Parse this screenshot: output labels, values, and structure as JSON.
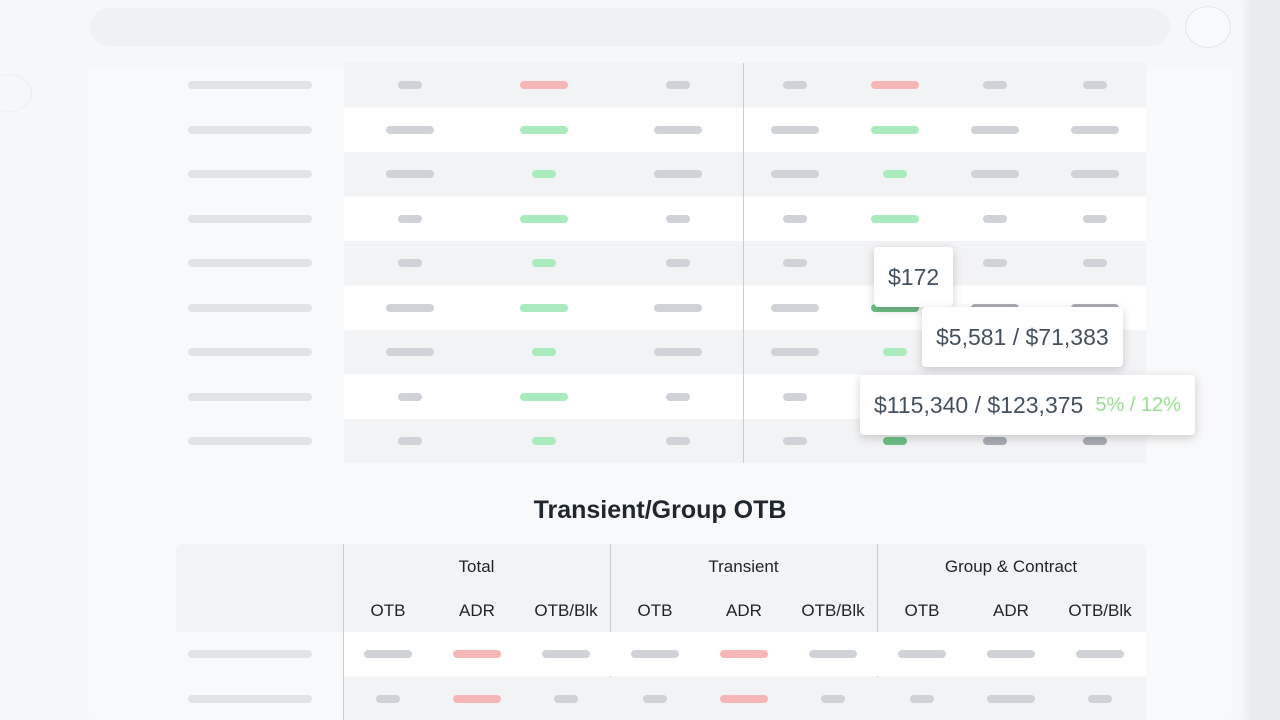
{
  "tooltips": {
    "rate": "$172",
    "revenue_a": "$5,581 / $71,383",
    "revenue_b": "$115,340 / $123,375",
    "revenue_b_pct": "5% / 12%"
  },
  "section": {
    "title": "Transient/Group OTB"
  },
  "otb_table": {
    "groups": [
      "Total",
      "Transient",
      "Group & Contract"
    ],
    "subheaders": [
      "OTB",
      "ADR",
      "OTB/Blk",
      "OTB",
      "ADR",
      "OTB/Blk",
      "OTB",
      "ADR",
      "OTB/Blk"
    ]
  },
  "colors": {
    "negative": "#f7b6b6",
    "positive": "#a9ebbd",
    "placeholder": "#cfd2d6",
    "percent_text": "#9bdc92"
  }
}
